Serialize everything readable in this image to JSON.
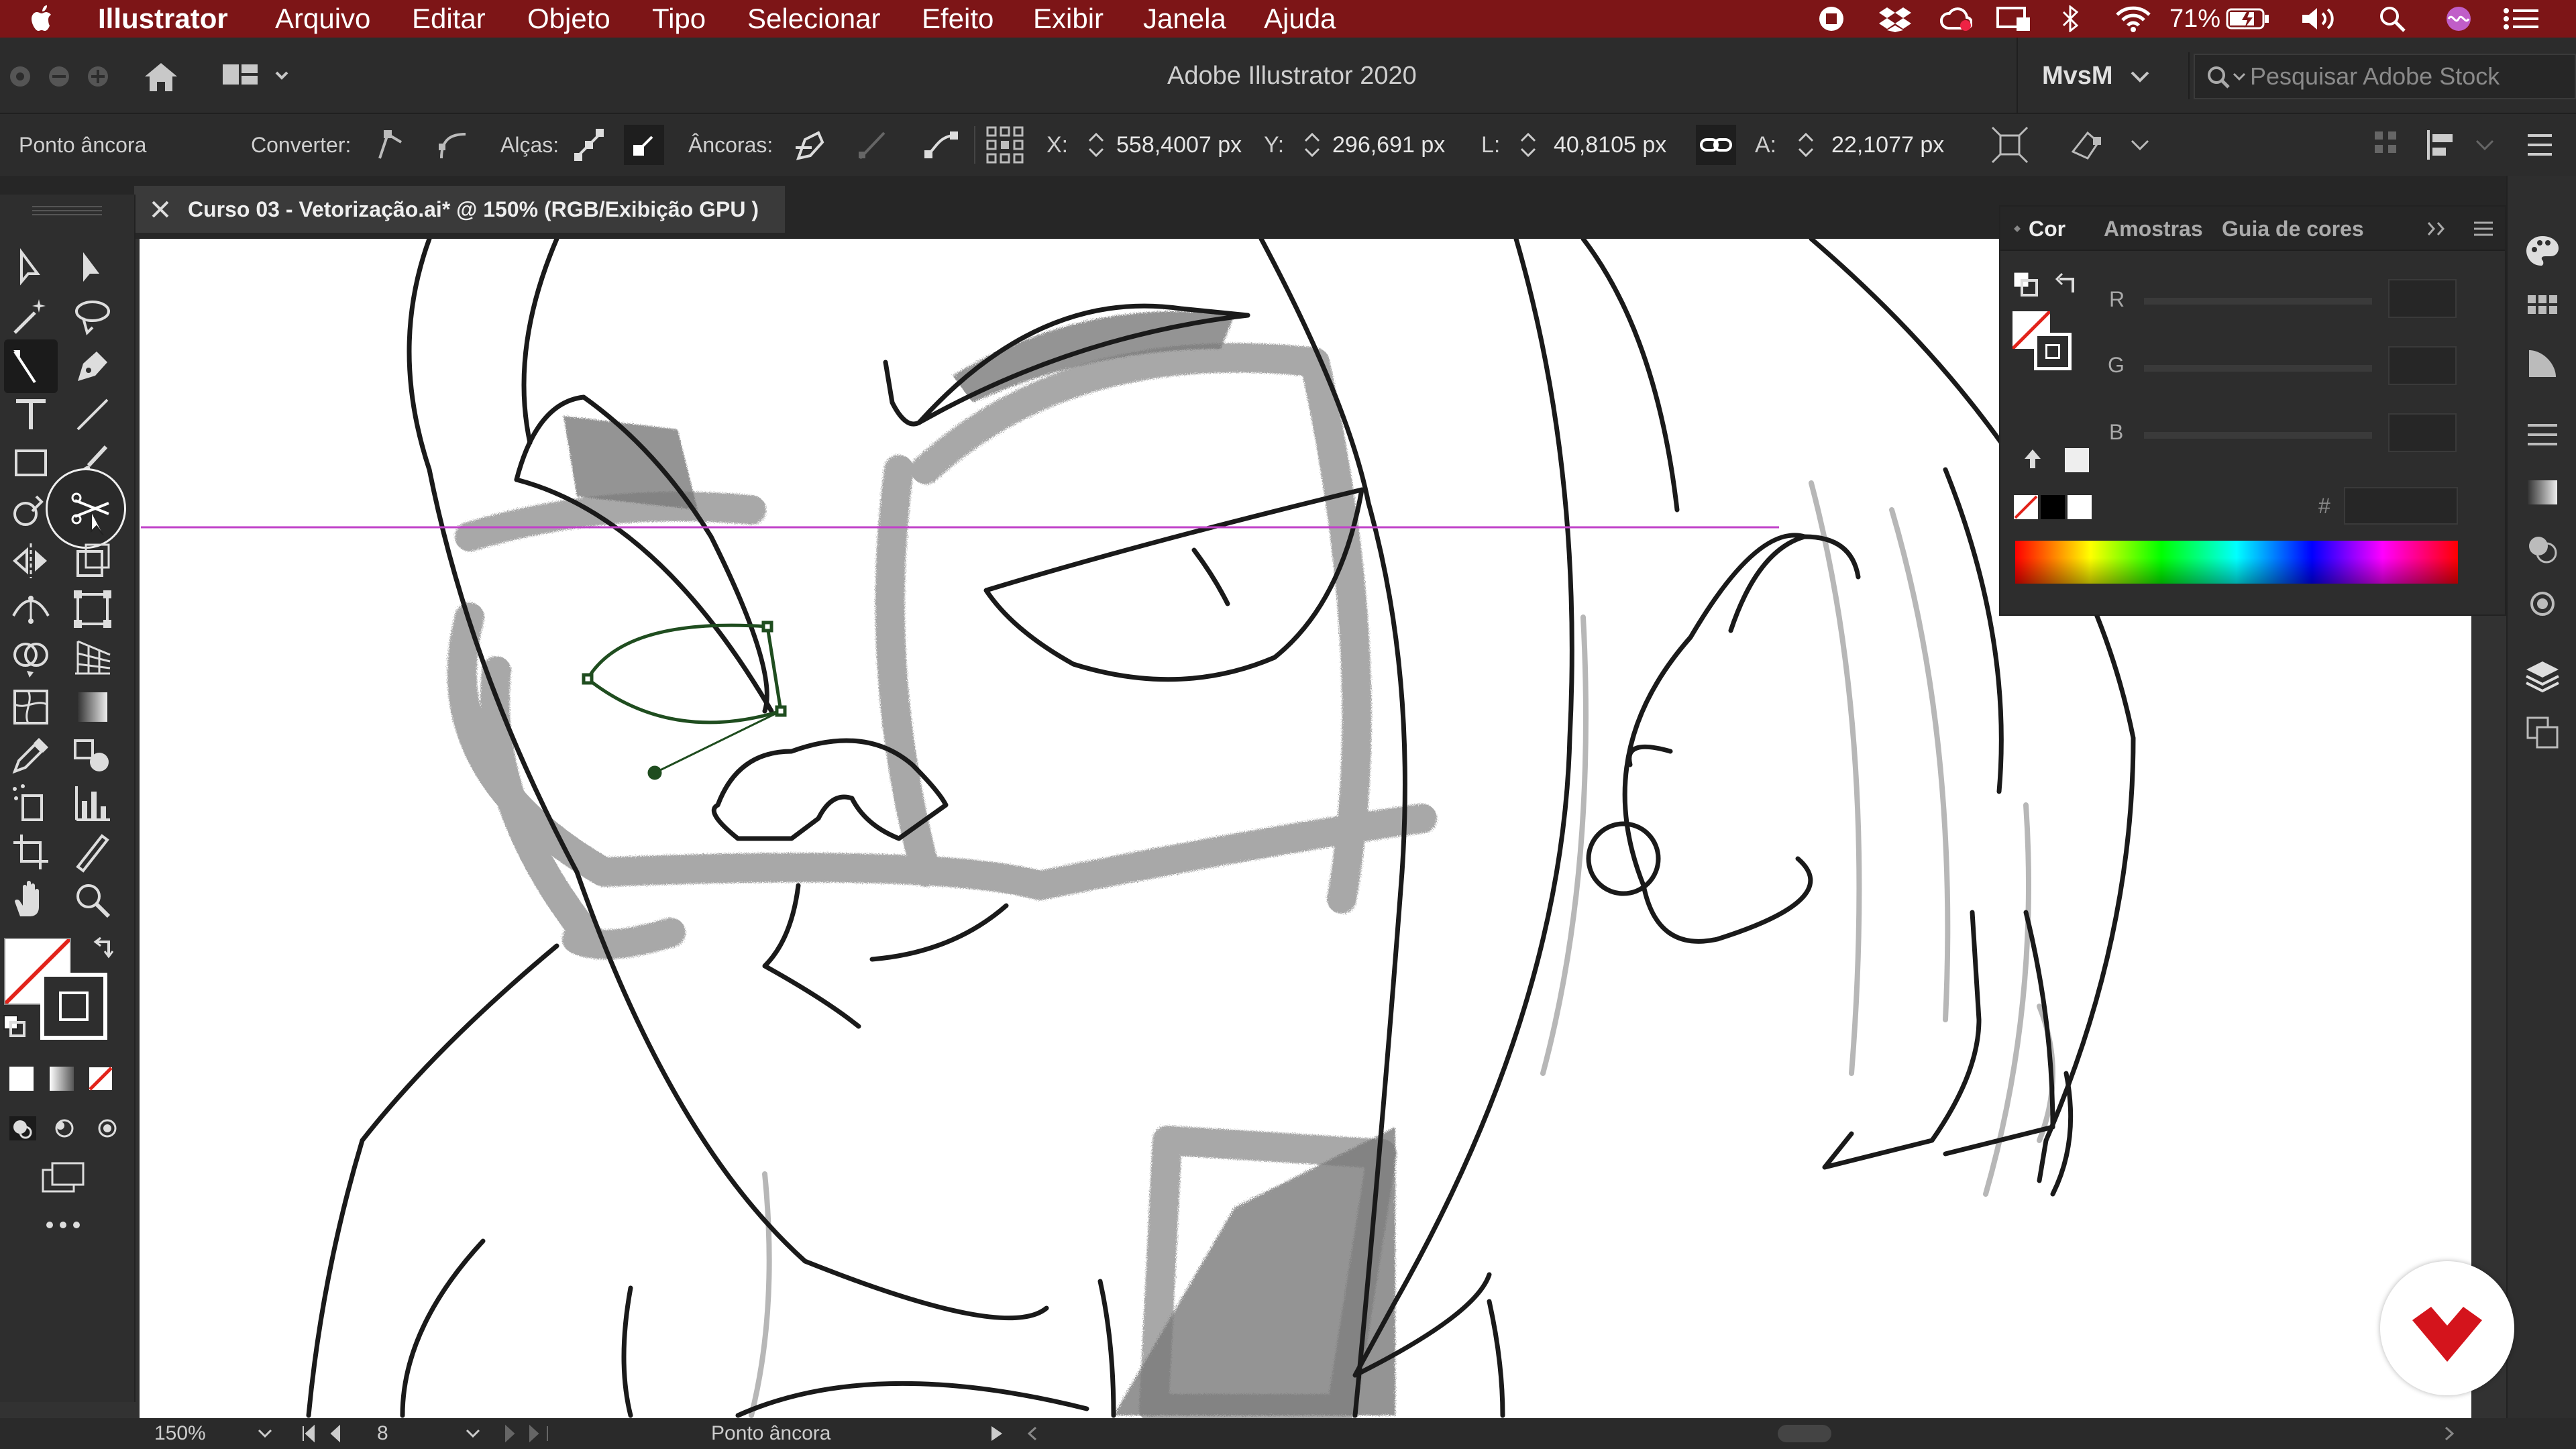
{
  "menubar": {
    "app_name": "Illustrator",
    "items": [
      "Arquivo",
      "Editar",
      "Objeto",
      "Tipo",
      "Selecionar",
      "Efeito",
      "Exibir",
      "Janela",
      "Ajuda"
    ],
    "battery": "71%"
  },
  "titlebar": {
    "title": "Adobe Illustrator 2020",
    "workspace": "MvsM",
    "search_placeholder": "Pesquisar Adobe Stock"
  },
  "control_bar": {
    "selection_label": "Ponto âncora",
    "convert_label": "Converter:",
    "handles_label": "Alças:",
    "anchors_label": "Âncoras:",
    "x_label": "X:",
    "x_value": "558,4007 px",
    "y_label": "Y:",
    "y_value": "296,691 px",
    "w_label": "L:",
    "w_value": "40,8105 px",
    "h_label": "A:",
    "h_value": "22,1077 px"
  },
  "document_tab": {
    "title": "Curso 03 - Vetorização.ai* @ 150% (RGB/Exibição GPU )"
  },
  "color_panel": {
    "tabs": [
      "Cor",
      "Amostras",
      "Guia de cores"
    ],
    "channels": [
      "R",
      "G",
      "B"
    ],
    "hex_label": "#"
  },
  "status_bar": {
    "zoom": "150%",
    "artboard": "8",
    "tool_name": "Ponto âncora"
  },
  "colors": {
    "menubar_bg": "#7d1517",
    "ui_bg": "#323232",
    "guide": "#c042c9",
    "path_selected": "#1f4d1f"
  }
}
